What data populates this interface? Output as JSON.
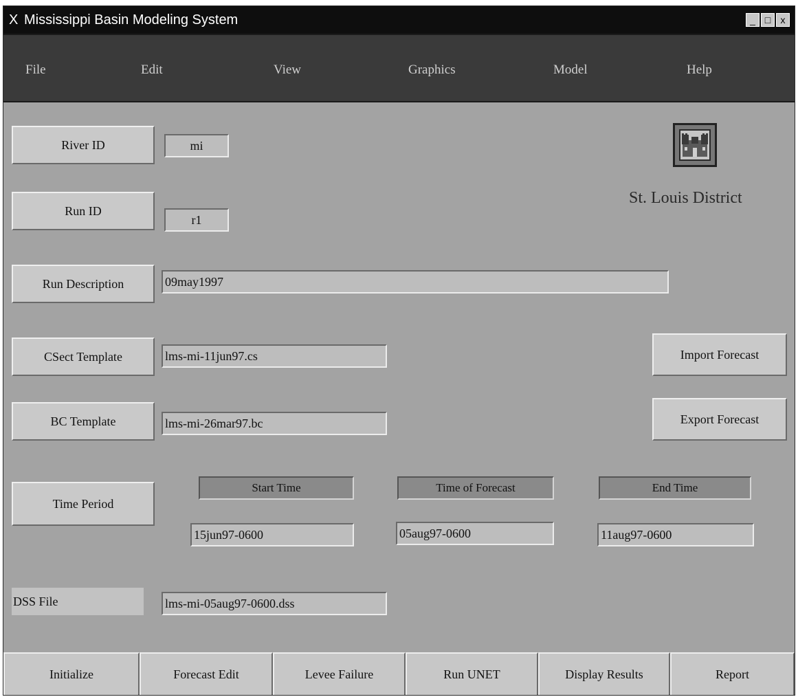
{
  "window": {
    "title": "Mississippi Basin Modeling System",
    "app_icon": "X",
    "controls": {
      "minimize": "_",
      "maximize": "□",
      "close": "x"
    }
  },
  "menu": [
    {
      "label": "File"
    },
    {
      "label": "Edit"
    },
    {
      "label": "View"
    },
    {
      "label": "Graphics"
    },
    {
      "label": "Model"
    },
    {
      "label": "Help"
    }
  ],
  "form": {
    "river_id": {
      "button": "River ID",
      "value": "mi"
    },
    "run_id": {
      "button": "Run ID",
      "value": "r1"
    },
    "run_description": {
      "button": "Run Description",
      "value": "09may1997"
    },
    "csect_template": {
      "button": "CSect Template",
      "value": "lms-mi-11jun97.cs"
    },
    "bc_template": {
      "button": "BC Template",
      "value": "lms-mi-26mar97.bc"
    },
    "time_period": {
      "button": "Time Period",
      "start_header": "Start Time",
      "forecast_header": "Time of Forecast",
      "end_header": "End Time",
      "start_value": "15jun97-0600",
      "forecast_value": "05aug97-0600",
      "end_value": "11aug97-0600"
    },
    "dss_file": {
      "label": "DSS File",
      "value": "lms-mi-05aug97-0600.dss"
    }
  },
  "side_actions": {
    "import_forecast": "Import Forecast",
    "export_forecast": "Export Forecast"
  },
  "branding": {
    "district": "St. Louis District",
    "logo_icon": "castle-icon"
  },
  "bottom_toolbar": [
    {
      "label": "Initialize"
    },
    {
      "label": "Forecast Edit"
    },
    {
      "label": "Levee Failure"
    },
    {
      "label": "Run UNET"
    },
    {
      "label": "Display Results"
    },
    {
      "label": "Report"
    }
  ]
}
